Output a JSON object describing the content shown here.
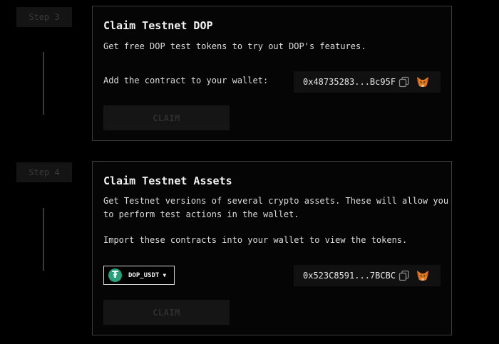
{
  "steps": {
    "step3_label": "Step 3",
    "step4_label": "Step 4"
  },
  "card_dop": {
    "title": "Claim Testnet DOP",
    "description": "Get free DOP test tokens to try out DOP's features.",
    "contract_label": "Add the contract to your wallet:",
    "contract_address": "0x48735283...Bc95F",
    "claim_label": "CLAIM"
  },
  "card_assets": {
    "title": "Claim Testnet Assets",
    "description_line1": "Get Testnet versions of several crypto assets. These will allow you",
    "description_line2": "to perform test actions in the wallet.",
    "import_text": "Import these contracts into your wallet to view the tokens.",
    "token_select": {
      "selected": "DOP_USDT",
      "icon": "tether-icon",
      "icon_glyph": "₮"
    },
    "contract_address": "0x523C8591...7BCBC",
    "claim_label": "CLAIM"
  },
  "colors": {
    "background": "#000000",
    "card_border": "#3c3c3c",
    "disabled_button": "#151515",
    "tether_green": "#26a17b",
    "metamask_orange": "#e2761b"
  },
  "icons": {
    "copy": "copy-icon",
    "wallet": "metamask-fox-icon"
  }
}
